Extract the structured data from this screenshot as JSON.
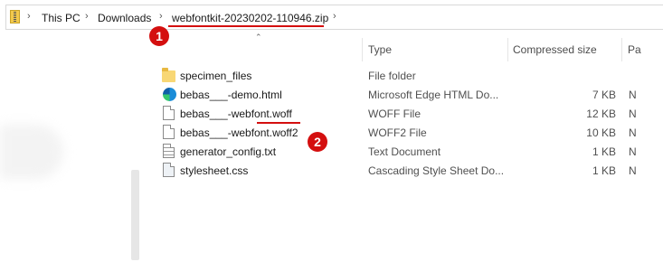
{
  "breadcrumb": {
    "items": [
      "This PC",
      "Downloads",
      "webfontkit-20230202-110946.zip"
    ],
    "separator": "›"
  },
  "annotations": {
    "badge1": "1",
    "badge2": "2",
    "color": "#d40f0f"
  },
  "columns": {
    "type": "Type",
    "compressed_size": "Compressed size",
    "ratio": "Pa"
  },
  "files": [
    {
      "name": "specimen_files",
      "type": "File folder",
      "size": "",
      "ratio": "",
      "icon": "folder-icon"
    },
    {
      "name": "bebas___-demo.html",
      "type": "Microsoft Edge HTML Do...",
      "size": "7 KB",
      "ratio": "N",
      "icon": "edge-icon"
    },
    {
      "name": "bebas___-webfont.woff",
      "type": "WOFF File",
      "size": "12 KB",
      "ratio": "N",
      "icon": "file-icon"
    },
    {
      "name": "bebas___-webfont.woff2",
      "type": "WOFF2 File",
      "size": "10 KB",
      "ratio": "N",
      "icon": "file-icon"
    },
    {
      "name": "generator_config.txt",
      "type": "Text Document",
      "size": "1 KB",
      "ratio": "N",
      "icon": "text-file-icon"
    },
    {
      "name": "stylesheet.css",
      "type": "Cascading Style Sheet Do...",
      "size": "1 KB",
      "ratio": "N",
      "icon": "css-file-icon"
    }
  ]
}
